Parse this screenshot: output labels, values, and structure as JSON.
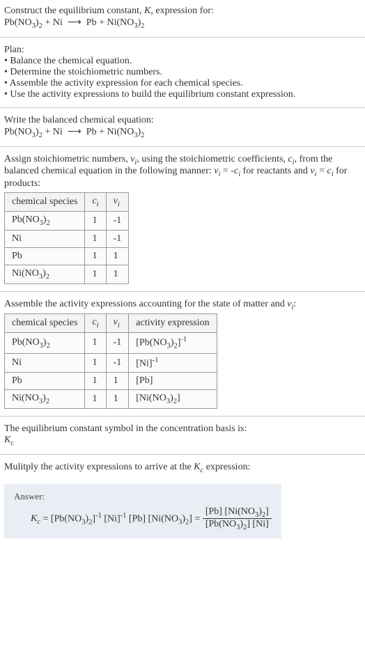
{
  "chart_data": [
    {
      "type": "table",
      "title": "Stoichiometric numbers",
      "columns": [
        "chemical species",
        "c_i",
        "ν_i"
      ],
      "rows": [
        [
          "Pb(NO₃)₂",
          "1",
          "-1"
        ],
        [
          "Ni",
          "1",
          "-1"
        ],
        [
          "Pb",
          "1",
          "1"
        ],
        [
          "Ni(NO₃)₂",
          "1",
          "1"
        ]
      ]
    },
    {
      "type": "table",
      "title": "Activity expressions",
      "columns": [
        "chemical species",
        "c_i",
        "ν_i",
        "activity expression"
      ],
      "rows": [
        [
          "Pb(NO₃)₂",
          "1",
          "-1",
          "[Pb(NO₃)₂]⁻¹"
        ],
        [
          "Ni",
          "1",
          "-1",
          "[Ni]⁻¹"
        ],
        [
          "Pb",
          "1",
          "1",
          "[Pb]"
        ],
        [
          "Ni(NO₃)₂",
          "1",
          "1",
          "[Ni(NO₃)₂]"
        ]
      ]
    }
  ],
  "intro": {
    "line1": "Construct the equilibrium constant, K, expression for:",
    "eq": "Pb(NO₃)₂ + Ni  ⟶  Pb + Ni(NO₃)₂"
  },
  "plan": {
    "heading": "Plan:",
    "b1": "• Balance the chemical equation.",
    "b2": "• Determine the stoichiometric numbers.",
    "b3": "• Assemble the activity expression for each chemical species.",
    "b4": "• Use the activity expressions to build the equilibrium constant expression."
  },
  "balanced": {
    "line1": "Write the balanced chemical equation:",
    "eq": "Pb(NO₃)₂ + Ni  ⟶  Pb + Ni(NO₃)₂"
  },
  "assign": {
    "text": "Assign stoichiometric numbers, νᵢ, using the stoichiometric coefficients, cᵢ, from the balanced chemical equation in the following manner: νᵢ = -cᵢ for reactants and νᵢ = cᵢ for products:"
  },
  "table1": {
    "h1": "chemical species",
    "h2": "cᵢ",
    "h3": "νᵢ",
    "r1c1": "Pb(NO₃)₂",
    "r1c2": "1",
    "r1c3": "-1",
    "r2c1": "Ni",
    "r2c2": "1",
    "r2c3": "-1",
    "r3c1": "Pb",
    "r3c2": "1",
    "r3c3": "1",
    "r4c1": "Ni(NO₃)₂",
    "r4c2": "1",
    "r4c3": "1"
  },
  "assemble": {
    "text": "Assemble the activity expressions accounting for the state of matter and νᵢ:"
  },
  "table2": {
    "h1": "chemical species",
    "h2": "cᵢ",
    "h3": "νᵢ",
    "h4": "activity expression",
    "r1c1": "Pb(NO₃)₂",
    "r1c2": "1",
    "r1c3": "-1",
    "r1c4": "[Pb(NO₃)₂]⁻¹",
    "r2c1": "Ni",
    "r2c2": "1",
    "r2c3": "-1",
    "r2c4": "[Ni]⁻¹",
    "r3c1": "Pb",
    "r3c2": "1",
    "r3c3": "1",
    "r3c4": "[Pb]",
    "r4c1": "Ni(NO₃)₂",
    "r4c2": "1",
    "r4c3": "1",
    "r4c4": "[Ni(NO₃)₂]"
  },
  "symbol": {
    "line1": "The equilibrium constant symbol in the concentration basis is:",
    "line2": "K_c"
  },
  "multiply": {
    "text": "Mulitply the activity expressions to arrive at the K_c expression:"
  },
  "answer": {
    "label": "Answer:",
    "lhs": "K_c = [Pb(NO₃)₂]⁻¹ [Ni]⁻¹ [Pb] [Ni(NO₃)₂] = ",
    "num": "[Pb] [Ni(NO₃)₂]",
    "den": "[Pb(NO₃)₂] [Ni]"
  }
}
